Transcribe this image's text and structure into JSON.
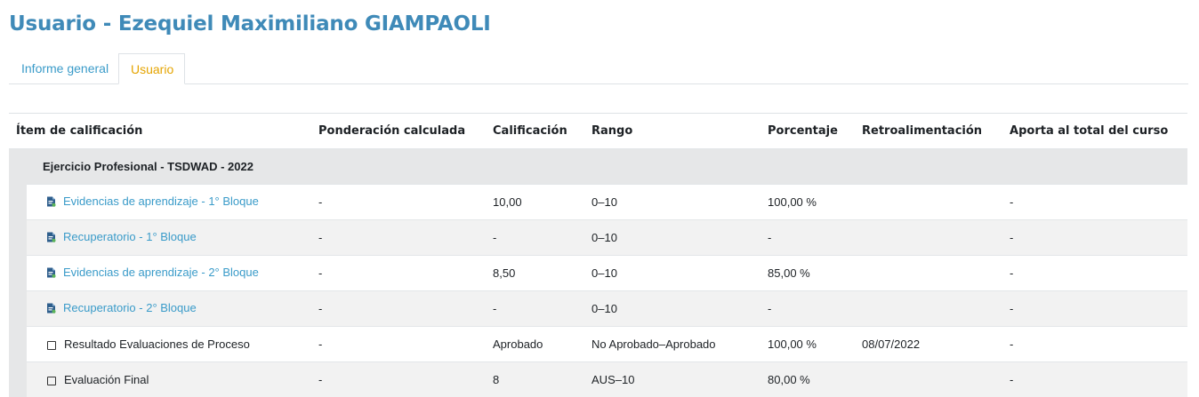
{
  "page": {
    "title": "Usuario - Ezequiel Maximiliano GIAMPAOLI"
  },
  "tabs": [
    {
      "label": "Informe general",
      "active": false
    },
    {
      "label": "Usuario",
      "active": true
    }
  ],
  "colors": {
    "accent": "#3a9bc9",
    "title": "#3f8ab8",
    "active_tab": "#e5a400"
  },
  "table": {
    "headers": [
      "Ítem de calificación",
      "Ponderación calculada",
      "Calificación",
      "Rango",
      "Porcentaje",
      "Retroalimentación",
      "Aporta al total del curso"
    ],
    "category": "Ejercicio Profesional - TSDWAD - 2022",
    "rows": [
      {
        "icon": "assignment-icon",
        "item": "Evidencias de aprendizaje - 1° Bloque",
        "weight": "-",
        "grade": "10,00",
        "range": "0–10",
        "percent": "100,00 %",
        "feedback": "",
        "contrib": "-"
      },
      {
        "icon": "assignment-icon",
        "item": "Recuperatorio - 1° Bloque",
        "weight": "-",
        "grade": "-",
        "range": "0–10",
        "percent": "-",
        "feedback": "",
        "contrib": "-"
      },
      {
        "icon": "assignment-icon",
        "item": "Evidencias de aprendizaje - 2° Bloque",
        "weight": "-",
        "grade": "8,50",
        "range": "0–10",
        "percent": "85,00 %",
        "feedback": "",
        "contrib": "-"
      },
      {
        "icon": "assignment-icon",
        "item": "Recuperatorio - 2° Bloque",
        "weight": "-",
        "grade": "-",
        "range": "0–10",
        "percent": "-",
        "feedback": "",
        "contrib": "-"
      },
      {
        "icon": "manual-item-icon",
        "item": "Resultado Evaluaciones de Proceso",
        "weight": "-",
        "grade": "Aprobado",
        "range": "No Aprobado–Aprobado",
        "percent": "100,00 %",
        "feedback": "08/07/2022",
        "contrib": "-"
      },
      {
        "icon": "manual-item-icon",
        "item": "Evaluación Final",
        "weight": "-",
        "grade": "8",
        "range": "AUS–10",
        "percent": "80,00 %",
        "feedback": "",
        "contrib": "-"
      }
    ]
  }
}
